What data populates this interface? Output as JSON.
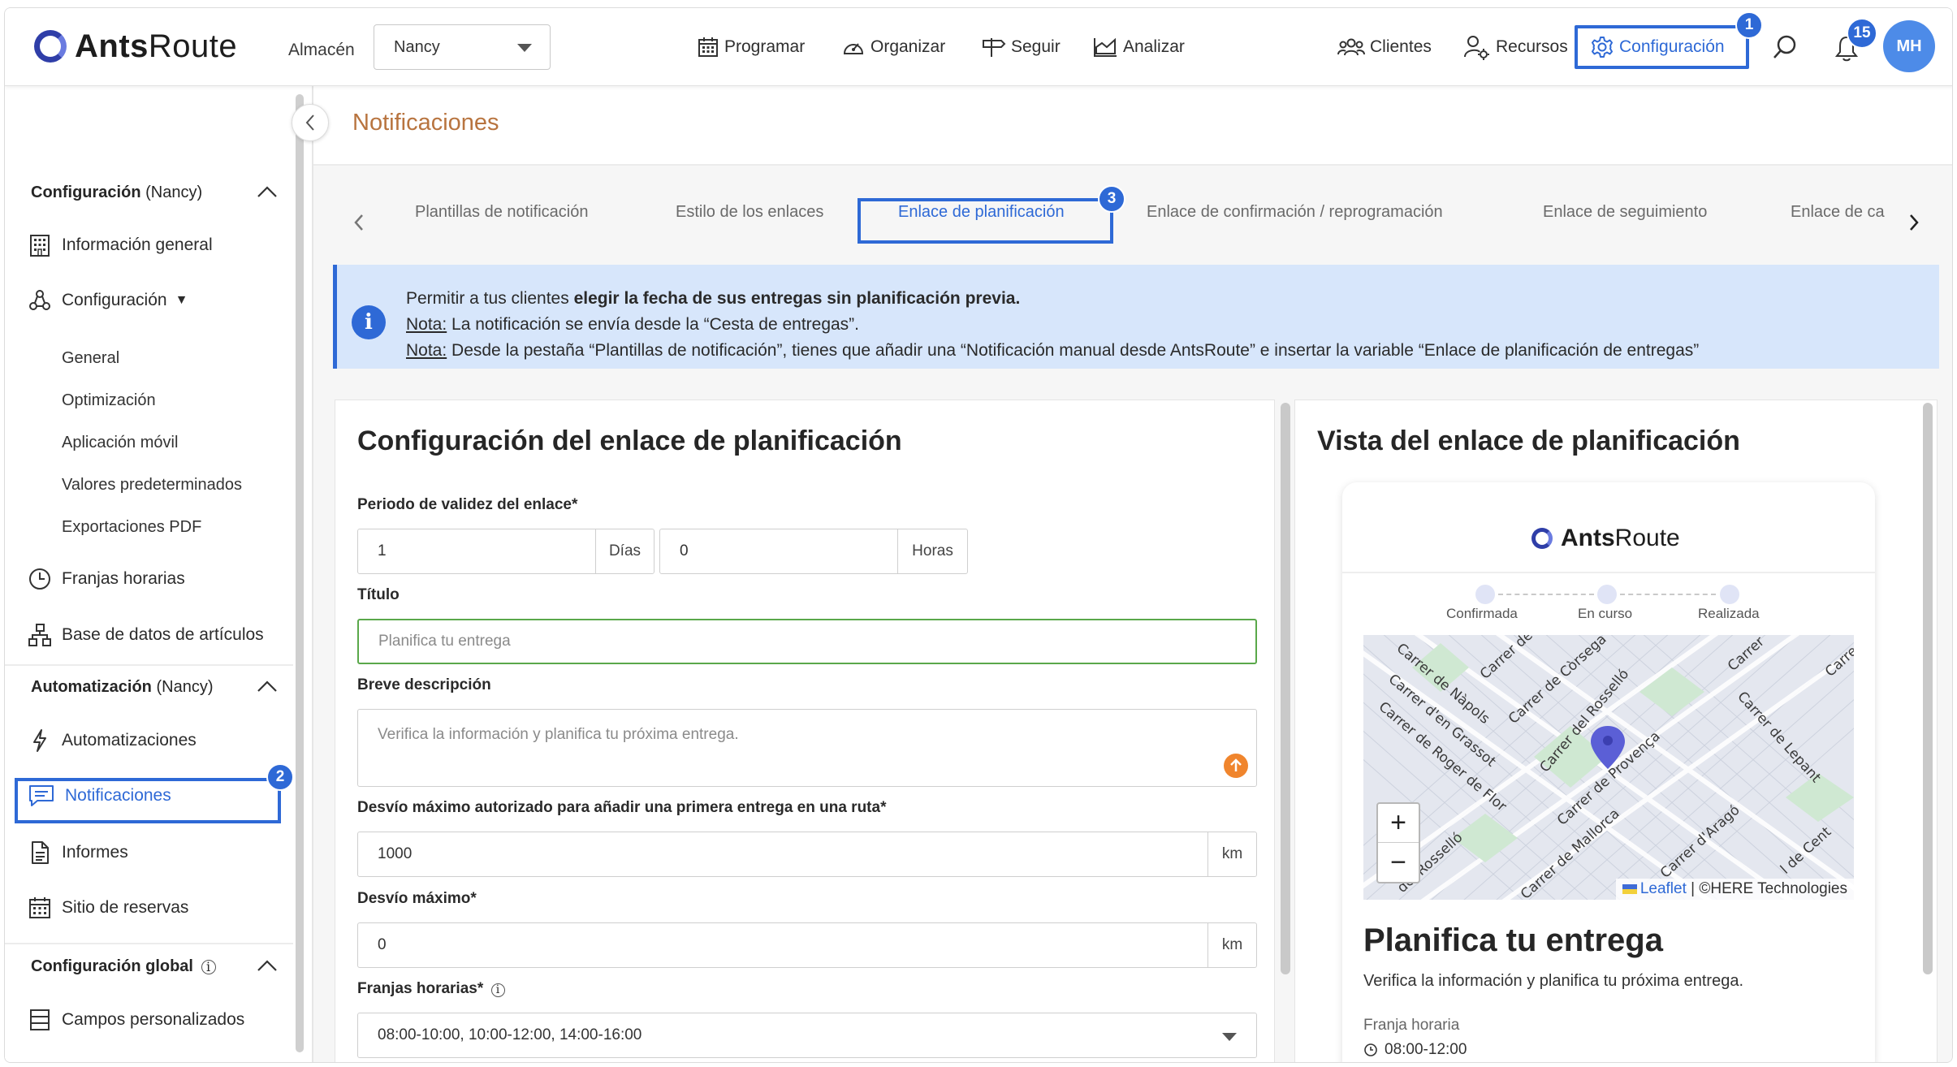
{
  "app": {
    "logo_bold": "Ants",
    "logo_light": "Route"
  },
  "topbar": {
    "warehouse_label": "Almacén",
    "warehouse_value": "Nancy",
    "nav": {
      "schedule": "Programar",
      "organize": "Organizar",
      "track": "Seguir",
      "analyze": "Analizar"
    },
    "right": {
      "clients": "Clientes",
      "resources": "Recursos",
      "settings": "Configuración"
    },
    "notifications_count": "15",
    "avatar_initials": "MH",
    "callout_1": "1"
  },
  "sidebar": {
    "section_config": {
      "title": "Configuración",
      "scope": "(Nancy)"
    },
    "general_info": "Información general",
    "configuration": "Configuración",
    "config_subitems": [
      "General",
      "Optimización",
      "Aplicación móvil",
      "Valores predeterminados",
      "Exportaciones PDF"
    ],
    "time_slots": "Franjas horarias",
    "items_db": "Base de datos de artículos",
    "section_automation": {
      "title": "Automatización",
      "scope": "(Nancy)"
    },
    "automations": "Automatizaciones",
    "notifications": "Notificaciones",
    "reports": "Informes",
    "booking_site": "Sitio de reservas",
    "section_global": {
      "title": "Configuración global"
    },
    "custom_fields": "Campos personalizados",
    "callout_2": "2"
  },
  "main": {
    "page_title": "Notificaciones",
    "tabs": [
      "Plantillas de notificación",
      "Estilo de los enlaces",
      "Enlace de planificación",
      "Enlace de confirmación / reprogramación",
      "Enlace de seguimiento",
      "Enlace de ca"
    ],
    "callout_3": "3",
    "info": {
      "line1_prefix": "Permitir a tus clientes ",
      "line1_bold": "elegir la fecha de sus entregas sin planificación previa.",
      "note_label": "Nota:",
      "line2": " La notificación se envía desde la “Cesta de entregas”.",
      "line3": " Desde la pestaña “Plantillas de notificación”, tienes que añadir una “Notificación manual desde AntsRoute” e insertar la variable “Enlace de planificación de entregas”"
    },
    "form": {
      "heading": "Configuración del enlace de planificación",
      "validity_label": "Periodo de validez del enlace*",
      "validity_days": "1",
      "days_unit": "Días",
      "validity_hours": "0",
      "hours_unit": "Horas",
      "title_label": "Título",
      "title_placeholder": "Planifica tu entrega",
      "desc_label": "Breve descripción",
      "desc_placeholder": "Verifica la información y planifica tu próxima entrega.",
      "max_first_label": "Desvío máximo autorizado para añadir una primera entrega en una ruta*",
      "max_first_value": "1000",
      "km": "km",
      "max_label": "Desvío máximo*",
      "max_value": "0",
      "slots_label": "Franjas horarias*",
      "slots_value": "08:00-10:00, 10:00-12:00, 14:00-16:00"
    },
    "preview": {
      "heading": "Vista del enlace de planificación",
      "steps": [
        "Confirmada",
        "En curso",
        "Realizada"
      ],
      "map_streets": [
        "Carrer de Nàpols",
        "Carrer de Còrsega",
        "Carrer del Rosselló",
        "Carrer d'en Grassot",
        "Carrer de Roger de Flor",
        "Carrer de Provença",
        "Carrer de Mallorca",
        "Carrer d'Aragó",
        "Carrer de Lepant",
        "Carrer",
        "del Rosselló",
        "Carrer de",
        "Carre",
        "Carrer de",
        "l de Cent"
      ],
      "zoom_in": "+",
      "zoom_out": "−",
      "attribution_leaflet": "Leaflet",
      "attribution_rest": " | ©HERE Technologies",
      "title": "Planifica tu entrega",
      "description": "Verifica la información y planifica tu próxima entrega.",
      "slot_label": "Franja horaria",
      "slot_value": "08:00-12:00"
    }
  },
  "colors": {
    "accent": "#2e69d6",
    "title_orange": "#b8743f",
    "info_bg": "#d7e6fb",
    "marker": "#5b5fd6"
  }
}
